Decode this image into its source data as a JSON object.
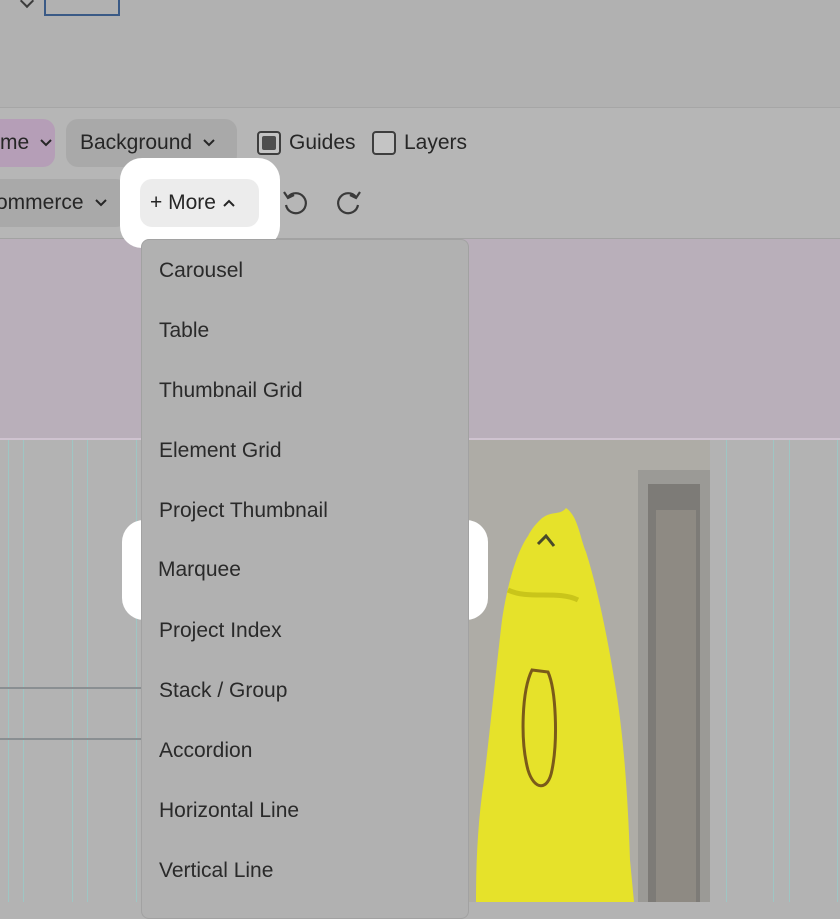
{
  "toolbar": {
    "theme_label": "me",
    "background_label": "Background",
    "commerce_label": "ommerce",
    "guides_label": "Guides",
    "guides_checked": true,
    "layers_label": "Layers",
    "layers_checked": false,
    "more_label": "+ More"
  },
  "menu": {
    "items": [
      {
        "label": "Carousel"
      },
      {
        "label": "Table"
      },
      {
        "label": "Thumbnail Grid"
      },
      {
        "label": "Element Grid"
      },
      {
        "label": "Project Thumbnail"
      },
      {
        "label": "Marquee"
      },
      {
        "label": "Project Index"
      },
      {
        "label": "Stack / Group"
      },
      {
        "label": "Accordion"
      },
      {
        "label": "Horizontal Line"
      },
      {
        "label": "Vertical Line"
      }
    ]
  },
  "icons": {
    "undo": "undo-icon",
    "redo": "redo-icon",
    "chevron_down": "chevron-down-icon",
    "chevron_up": "chevron-up-icon"
  },
  "colors": {
    "highlight": "#ffffff",
    "theme_pill": "#b59eb7",
    "guide_lines": "#9ec6c4",
    "bag_yellow": "#e6e22a"
  }
}
